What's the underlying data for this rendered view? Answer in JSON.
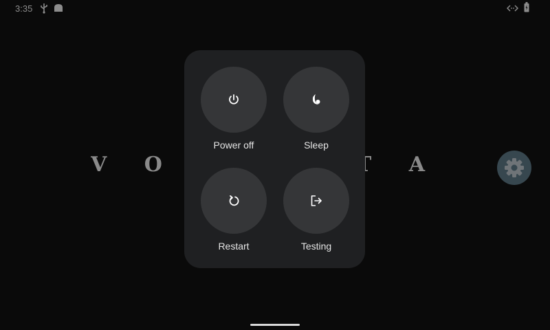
{
  "status_bar": {
    "time": "3:35",
    "icons": [
      "usb-icon",
      "android-icon",
      "data-link-icon",
      "battery-charging-icon"
    ]
  },
  "background": {
    "logo_visible_text": "V O I   E N T A"
  },
  "power_menu": {
    "items": [
      {
        "label": "Power off",
        "icon": "power-icon"
      },
      {
        "label": "Sleep",
        "icon": "moon-icon"
      },
      {
        "label": "Restart",
        "icon": "restart-icon"
      },
      {
        "label": "Testing",
        "icon": "logout-icon"
      }
    ]
  },
  "colors": {
    "background": "#0a0a0a",
    "panel": "#1f2022",
    "button": "#353638",
    "settings_fab": "#37474f",
    "text": "#e6e6e6"
  }
}
